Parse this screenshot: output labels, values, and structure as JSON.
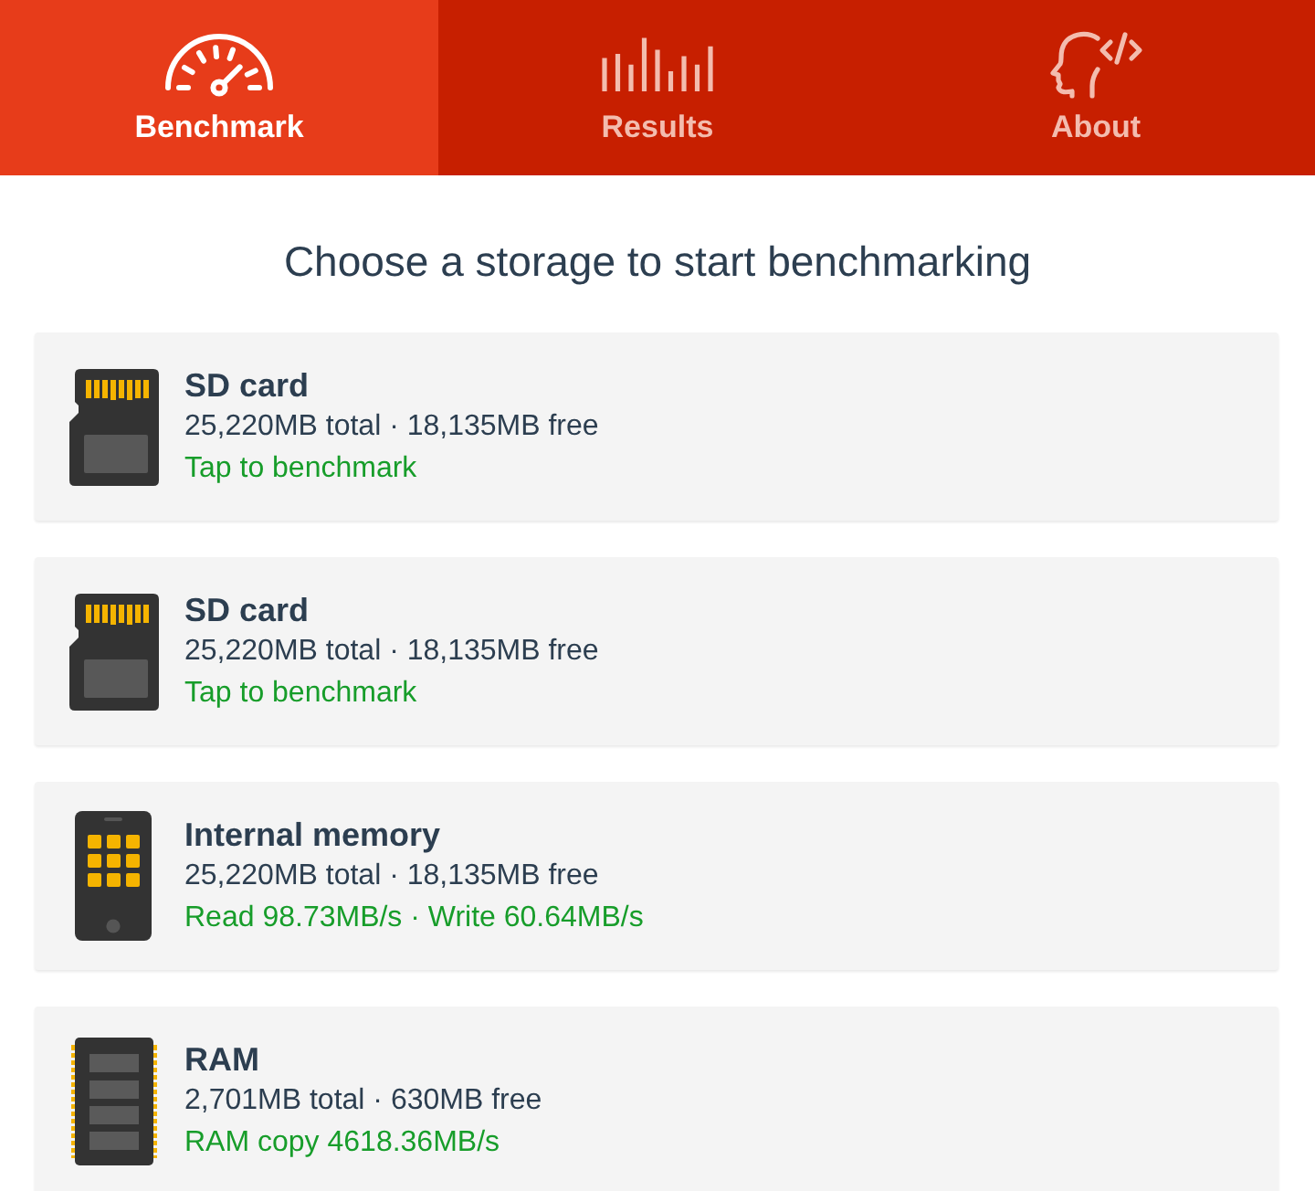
{
  "tabs": [
    {
      "label": "Benchmark",
      "kind": "gauge",
      "selected": true
    },
    {
      "label": "Results",
      "kind": "bars",
      "selected": false
    },
    {
      "label": "About",
      "kind": "head",
      "selected": false
    }
  ],
  "heading": "Choose a storage to start benchmarking",
  "storages": [
    {
      "kind": "sd-card",
      "name": "SD card",
      "size": "25,220MB total · 18,135MB free",
      "status": "Tap to benchmark"
    },
    {
      "kind": "sd-card",
      "name": "SD card",
      "size": "25,220MB total · 18,135MB free",
      "status": "Tap to benchmark"
    },
    {
      "kind": "phone",
      "name": "Internal memory",
      "size": "25,220MB total · 18,135MB free",
      "status": "Read 98.73MB/s · Write 60.64MB/s"
    },
    {
      "kind": "ram",
      "name": "RAM",
      "size": "2,701MB total · 630MB free",
      "status": "RAM copy 4618.36MB/s"
    }
  ]
}
